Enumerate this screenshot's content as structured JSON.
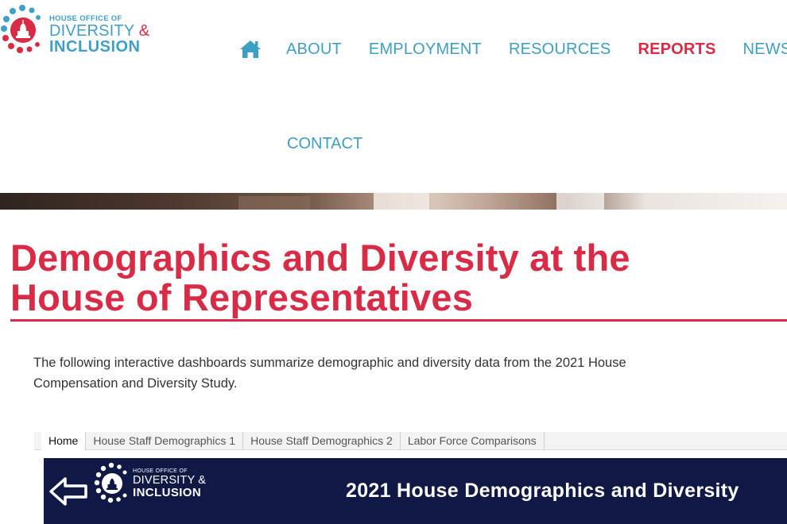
{
  "site": {
    "logo": {
      "line1": "HOUSE OFFICE OF",
      "line2": "DIVERSITY",
      "ampersand": "&",
      "line3": "INCLUSION"
    },
    "colors": {
      "brand_blue": "#3d9fc6",
      "brand_red": "#d92b45",
      "navy": "#101846"
    }
  },
  "nav": {
    "home_icon": "home-icon",
    "items": [
      {
        "label": "ABOUT",
        "active": false
      },
      {
        "label": "EMPLOYMENT",
        "active": false
      },
      {
        "label": "RESOURCES",
        "active": false
      },
      {
        "label": "REPORTS",
        "active": true
      },
      {
        "label": "NEWS",
        "active": false
      }
    ],
    "contact": "CONTACT"
  },
  "page": {
    "title_line1": "Demographics and Diversity at the",
    "title_line2": "House of Representatives",
    "intro_line1": "The following interactive dashboards summarize demographic and diversity data from the 2021 House",
    "intro_line2": "Compensation and Diversity Study."
  },
  "dashboard": {
    "tabs": [
      {
        "label": "Home",
        "active": true
      },
      {
        "label": "House Staff Demographics 1",
        "active": false
      },
      {
        "label": "House Staff Demographics 2",
        "active": false
      },
      {
        "label": "Labor Force Comparisons",
        "active": false
      }
    ],
    "back_icon": "back-arrow-icon",
    "logo": {
      "line1": "HOUSE OFFICE OF",
      "line2": "DIVERSITY &",
      "line3": "INCLUSION"
    },
    "title": "2021 House Demographics and Diversity"
  }
}
